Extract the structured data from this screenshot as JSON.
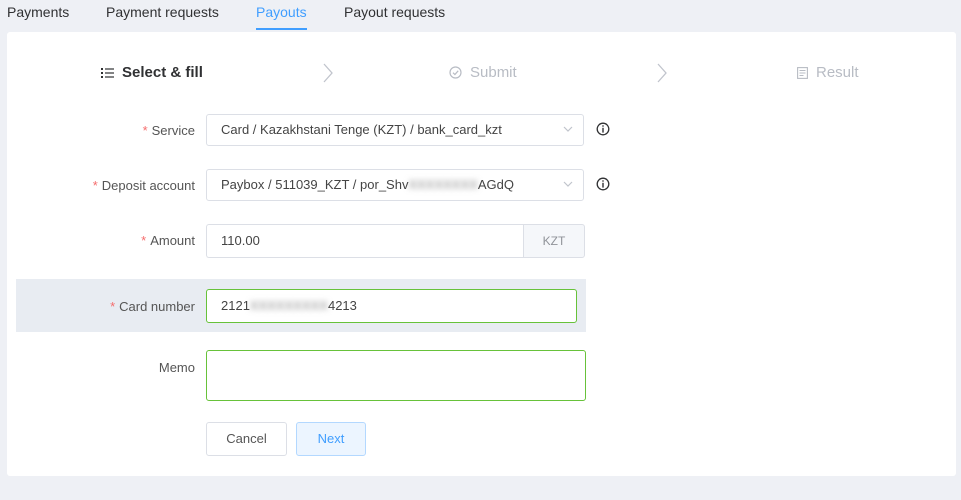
{
  "tabs": [
    "Payments",
    "Payment requests",
    "Payouts",
    "Payout requests"
  ],
  "active_tab": "Payouts",
  "steps": [
    {
      "label": "Select & fill",
      "icon": "list-icon",
      "state": "active"
    },
    {
      "label": "Submit",
      "icon": "check-circle-icon",
      "state": "inactive"
    },
    {
      "label": "Result",
      "icon": "document-icon",
      "state": "inactive"
    }
  ],
  "form": {
    "required_mark": "*",
    "service": {
      "label": "Service",
      "value": {
        "part1": "Card",
        "sep": " / ",
        "part2": "Kazakhstani Tenge (KZT)",
        "part3": "bank_card_kzt"
      }
    },
    "deposit_account": {
      "label": "Deposit account",
      "value": {
        "part1": "Paybox",
        "sep": " / ",
        "part2": "511039_KZT",
        "part3_start": "por_Shv",
        "part3_hidden": "XXXXXXXX",
        "part3_end": "AGdQ"
      }
    },
    "amount": {
      "label": "Amount",
      "value": "110.00",
      "suffix": "KZT"
    },
    "card_number": {
      "label": "Card number",
      "start": "2121",
      "hidden": "XXXXXXXXX",
      "end": "4213"
    },
    "memo": {
      "label": "Memo",
      "value": ""
    }
  },
  "buttons": {
    "cancel": "Cancel",
    "next": "Next"
  },
  "colors": {
    "accent": "#409eff",
    "required": "#f56c6c",
    "valid_border": "#67c23a",
    "background": "#eef0f5"
  }
}
